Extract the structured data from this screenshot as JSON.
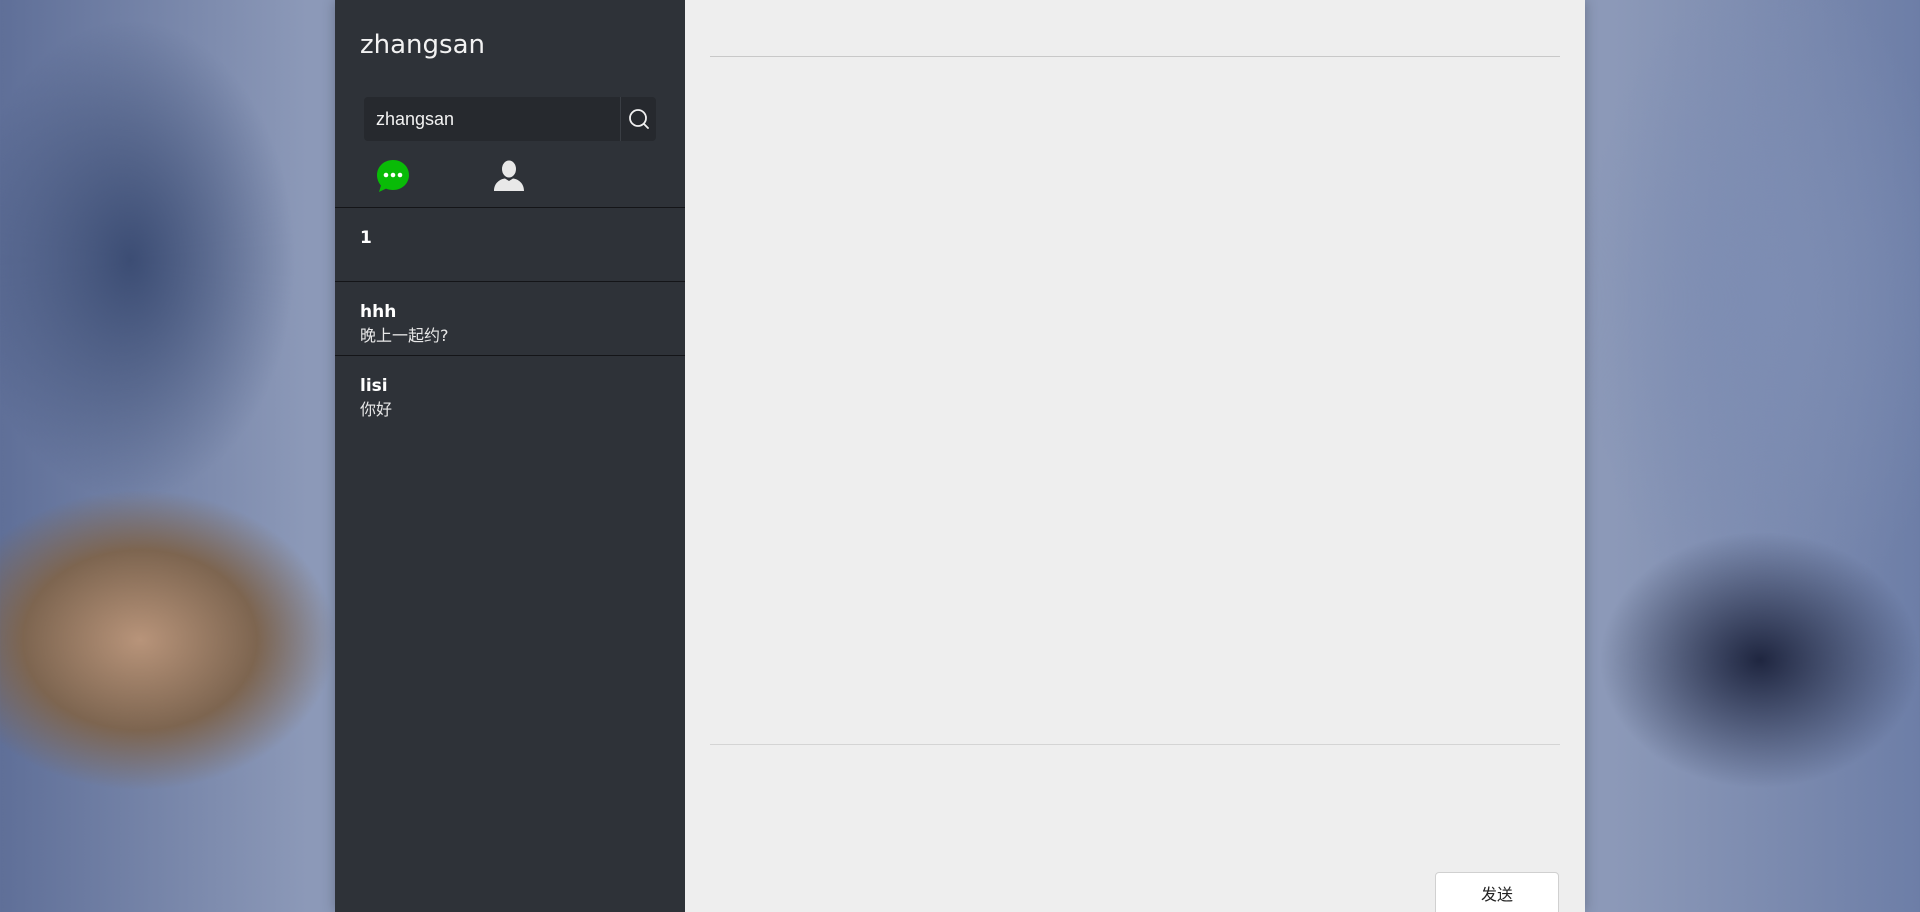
{
  "user": {
    "name": "zhangsan"
  },
  "search": {
    "value": "zhangsan",
    "placeholder": ""
  },
  "nav": {
    "chat_icon": "chat-bubble-icon",
    "contacts_icon": "user-icon",
    "active_color": "#09bb07",
    "inactive_color": "#e8e8e8"
  },
  "sessions": [
    {
      "name": "1",
      "last_message": ""
    },
    {
      "name": "hhh",
      "last_message": "晚上一起约?"
    },
    {
      "name": "lisi",
      "last_message": "你好"
    }
  ],
  "chat": {
    "send_label": "发送"
  }
}
